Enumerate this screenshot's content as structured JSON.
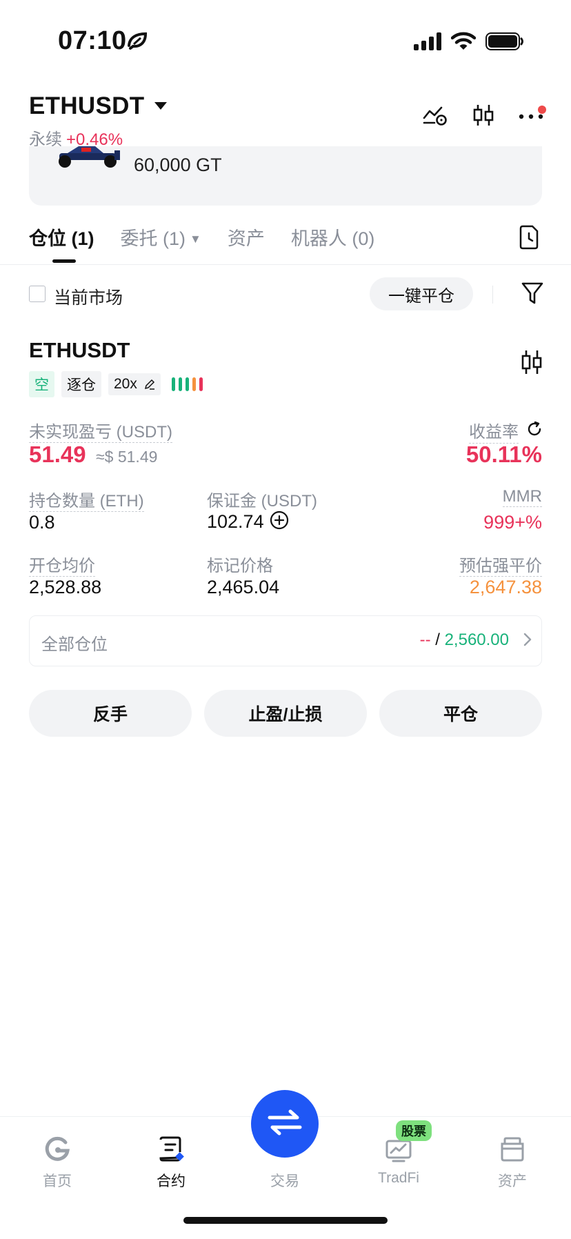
{
  "status_bar": {
    "time": "07:10"
  },
  "header": {
    "symbol": "ETHUSDT",
    "contract_type": "永续",
    "change_pct": "+0.46%"
  },
  "banner": {
    "text": "60,000 GT"
  },
  "tabs": [
    {
      "label": "仓位 (1)",
      "active": true
    },
    {
      "label": "委托 (1)",
      "active": false
    },
    {
      "label": "资产",
      "active": false
    },
    {
      "label": "机器人 (0)",
      "active": false
    }
  ],
  "filter": {
    "current_market_label": "当前市场",
    "close_all_label": "一键平仓"
  },
  "position": {
    "symbol": "ETHUSDT",
    "tags": {
      "side": "空",
      "margin_mode": "逐仓",
      "leverage": "20x"
    },
    "unrealized_pnl_label": "未实现盈亏 (USDT)",
    "unrealized_pnl": "51.49",
    "unrealized_pnl_approx": "≈$ 51.49",
    "roi_label": "收益率",
    "roi": "50.11%",
    "size_label": "持仓数量 (ETH)",
    "size": "0.8",
    "margin_label": "保证金 (USDT)",
    "margin": "102.74",
    "mmr_label": "MMR",
    "mmr": "999+%",
    "entry_price_label": "开仓均价",
    "entry_price": "2,528.88",
    "mark_price_label": "标记价格",
    "mark_price": "2,465.04",
    "liq_price_label": "预估强平价",
    "liq_price": "2,647.38",
    "all_positions_label": "全部仓位",
    "all_positions_pnl": "--",
    "all_positions_sep": " / ",
    "all_positions_value": "2,560.00"
  },
  "actions": {
    "reverse": "反手",
    "tp_sl": "止盈/止损",
    "close": "平仓"
  },
  "nav": {
    "home": "首页",
    "futures": "合约",
    "trade": "交易",
    "tradfi": "TradFi",
    "tradfi_badge": "股票",
    "assets": "资产"
  },
  "colors": {
    "red": "#e8335a",
    "green": "#18b27a",
    "orange": "#f5923e",
    "blue": "#1f57f5"
  }
}
